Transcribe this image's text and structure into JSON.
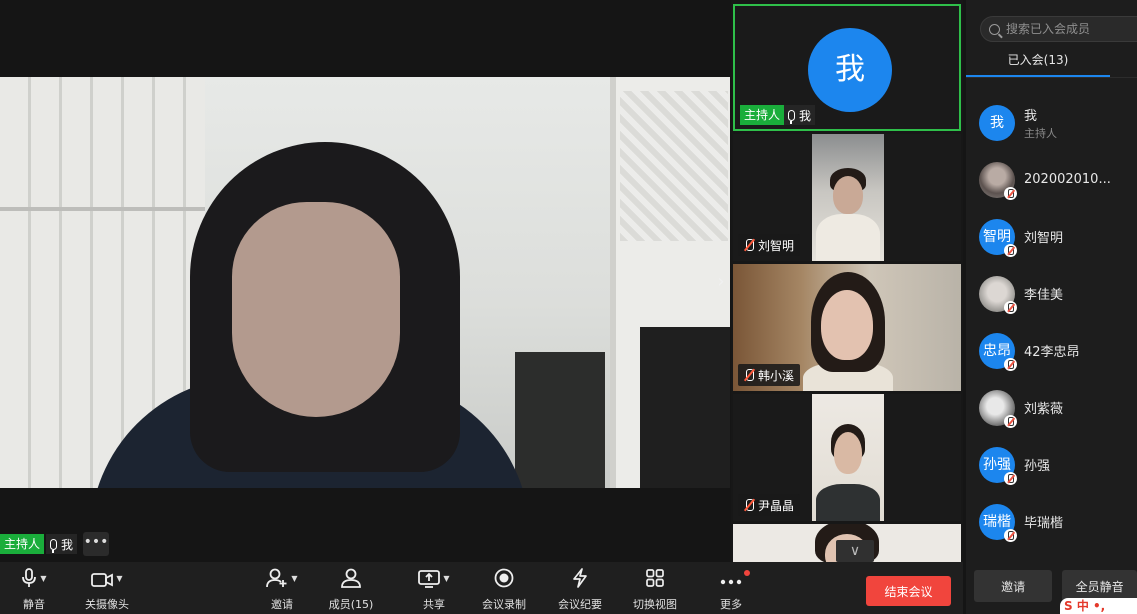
{
  "main": {
    "host_label": "主持人",
    "self_label": "我",
    "more_label": "•••",
    "next_label": "›"
  },
  "thumbs": {
    "host": {
      "avatar_text": "我",
      "host_label": "主持人",
      "self_label": "我"
    },
    "items": [
      {
        "name": "刘智明"
      },
      {
        "name": "韩小溪"
      },
      {
        "name": "尹晶晶"
      }
    ],
    "scroll_label": "∨"
  },
  "panel": {
    "search_placeholder": "搜索已入会成员",
    "tab_label": "已入会(13)",
    "members": [
      {
        "avatar_text": "我",
        "name": "我",
        "role": "主持人"
      },
      {
        "avatar_text": "",
        "name": "202002010..."
      },
      {
        "avatar_text": "智明",
        "name": "刘智明"
      },
      {
        "avatar_text": "",
        "name": "李佳美"
      },
      {
        "avatar_text": "忠昂",
        "name": "42李忠昂"
      },
      {
        "avatar_text": "",
        "name": "刘紫薇"
      },
      {
        "avatar_text": "孙强",
        "name": "孙强"
      },
      {
        "avatar_text": "瑞楷",
        "name": "毕瑞楷"
      }
    ],
    "invite_label": "邀请",
    "mute_all_label": "全员静音",
    "ime_label": "S 中 •,"
  },
  "toolbar": {
    "mute": "静音",
    "camera": "关摄像头",
    "invite": "邀请",
    "members": "成员(15)",
    "share": "共享",
    "record": "会议录制",
    "minutes": "会议纪要",
    "view": "切换视图",
    "more": "更多",
    "end": "结束会议"
  },
  "colors": {
    "accent": "#1c86ee",
    "host_green": "#1aad3b",
    "active_border": "#2fbf4a",
    "end_red": "#f1453d"
  }
}
